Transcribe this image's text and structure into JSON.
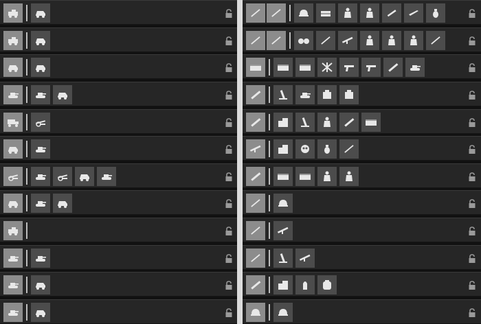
{
  "colors": {
    "row_bg": "#262626",
    "primary_slot": "#8c8c8c",
    "item_slot": "#4c4c4c",
    "divider": "#dcdcdc",
    "lock_icon": "#9a9a9a",
    "icon_fill": "#e8e8e8"
  },
  "left_rows": [
    {
      "primary": [
        "vehicle-transport-icon"
      ],
      "items": [
        "armored-car-icon"
      ]
    },
    {
      "primary": [
        "vehicle-transport-icon"
      ],
      "items": [
        "armored-car-icon"
      ]
    },
    {
      "primary": [
        "armored-car-icon"
      ],
      "items": [
        "armored-car-icon"
      ]
    },
    {
      "primary": [
        "tank-icon"
      ],
      "items": [
        "tank-icon",
        "armored-car-icon"
      ]
    },
    {
      "primary": [
        "truck-icon"
      ],
      "items": [
        "field-gun-icon"
      ]
    },
    {
      "primary": [
        "armored-car-icon"
      ],
      "items": [
        "tank-icon"
      ]
    },
    {
      "primary": [
        "field-gun-icon"
      ],
      "items": [
        "tank-icon",
        "field-gun-icon",
        "armored-car-icon",
        "tank-icon"
      ]
    },
    {
      "primary": [
        "armored-car-icon"
      ],
      "items": [
        "tank-icon",
        "armored-car-icon"
      ]
    },
    {
      "primary": [
        "vehicle-transport-icon"
      ],
      "items": []
    },
    {
      "primary": [
        "tank-icon"
      ],
      "items": [
        "tank-icon"
      ]
    },
    {
      "primary": [
        "tank-icon"
      ],
      "items": [
        "armored-car-icon"
      ]
    },
    {
      "primary": [
        "tank-icon"
      ],
      "items": [
        "armored-car-icon"
      ]
    }
  ],
  "right_rows": [
    {
      "primary": [
        "rifle-icon",
        "rifle-icon"
      ],
      "items": [
        "helmet-icon",
        "crate-icon",
        "soldier-icon",
        "soldier-icon",
        "bayonet-icon",
        "knife-icon",
        "grenade-icon"
      ]
    },
    {
      "primary": [
        "rifle-icon",
        "rifle-icon"
      ],
      "items": [
        "binoculars-icon",
        "rifle-icon",
        "machine-gun-icon",
        "soldier-icon",
        "soldier-icon",
        "soldier-icon",
        "rifle-icon"
      ]
    },
    {
      "primary": [
        "ammo-box-icon"
      ],
      "items": [
        "ammo-box-icon",
        "ammo-box-icon",
        "barbed-wire-icon",
        "pistol-icon",
        "pistol-icon",
        "rocket-launcher-icon",
        "tank-icon"
      ]
    },
    {
      "primary": [
        "rocket-launcher-icon"
      ],
      "items": [
        "mortar-icon",
        "tank-icon",
        "supply-box-icon",
        "supply-box-icon"
      ]
    },
    {
      "primary": [
        "rocket-launcher-icon"
      ],
      "items": [
        "building-icon",
        "mortar-icon",
        "soldier-icon",
        "rocket-launcher-icon",
        "ammo-box-icon"
      ]
    },
    {
      "primary": [
        "machine-gun-icon"
      ],
      "items": [
        "building-icon",
        "mask-icon",
        "grenade-icon",
        "rifle-icon"
      ]
    },
    {
      "primary": [
        "rocket-launcher-icon"
      ],
      "items": [
        "ammo-box-icon",
        "ammo-box-icon",
        "soldier-icon",
        "soldier-icon"
      ]
    },
    {
      "primary": [
        "rifle-icon"
      ],
      "items": [
        "helmet-icon"
      ]
    },
    {
      "primary": [
        "rifle-icon"
      ],
      "items": [
        "machine-gun-icon"
      ]
    },
    {
      "primary": [
        "rifle-icon"
      ],
      "items": [
        "mortar-icon",
        "machine-gun-icon"
      ]
    },
    {
      "primary": [
        "rocket-launcher-icon"
      ],
      "items": [
        "building-icon",
        "shell-icon",
        "backpack-icon"
      ]
    },
    {
      "primary": [
        "helmet-icon"
      ],
      "items": [
        "helmet-icon"
      ]
    }
  ]
}
